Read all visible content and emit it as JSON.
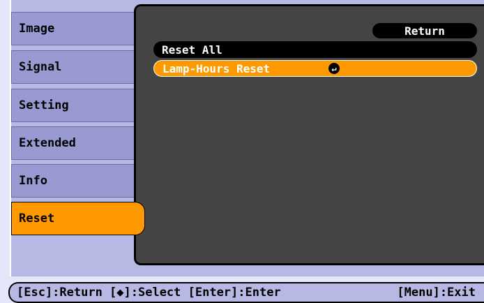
{
  "sidebar": {
    "items": [
      {
        "label": "Image"
      },
      {
        "label": "Signal"
      },
      {
        "label": "Setting"
      },
      {
        "label": "Extended"
      },
      {
        "label": "Info"
      },
      {
        "label": "Reset"
      }
    ],
    "active_index": 5
  },
  "panel": {
    "return_label": "Return",
    "items": [
      {
        "label": "Reset All"
      },
      {
        "label": "Lamp-Hours Reset"
      }
    ],
    "selected_index": 1
  },
  "footer": {
    "left_text": "[Esc]:Return [◆]:Select [Enter]:Enter",
    "right_text": "[Menu]:Exit"
  },
  "colors": {
    "highlight": "#ff9900",
    "panel_bg": "#444444",
    "tab_bg": "#9a9ad2",
    "page_bg": "#e6e6fa"
  }
}
